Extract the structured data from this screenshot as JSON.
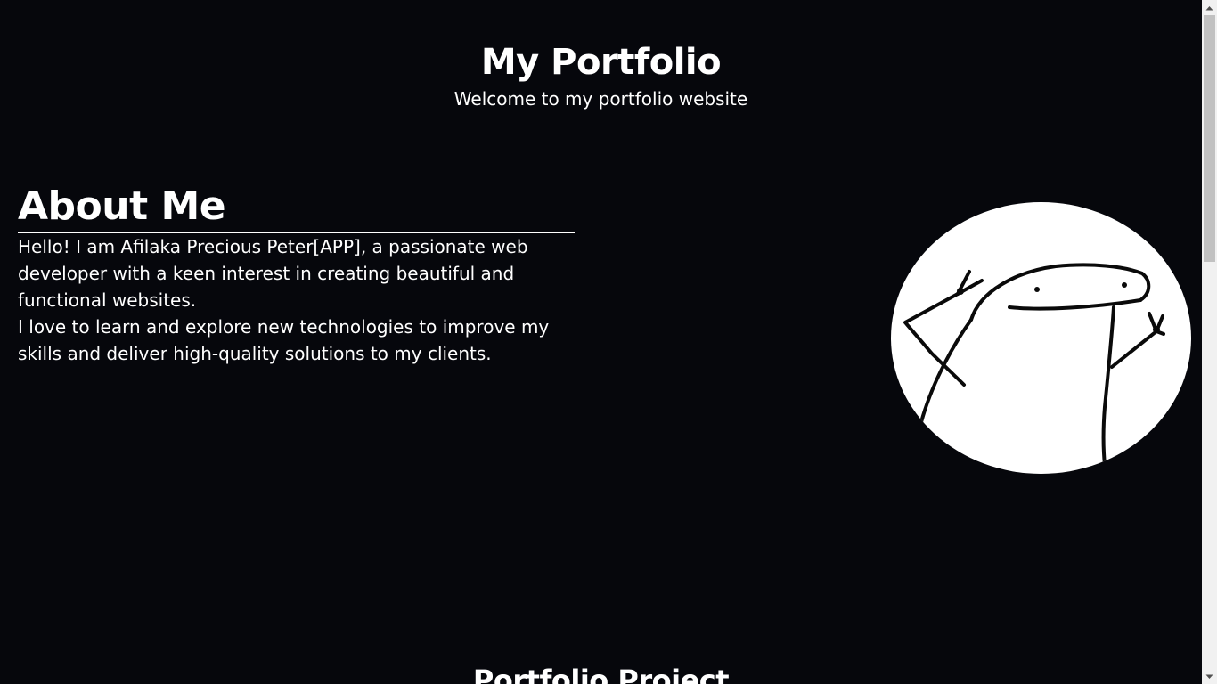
{
  "header": {
    "title": "My Portfolio",
    "subtitle": "Welcome to my portfolio website"
  },
  "about": {
    "heading": "About Me",
    "paragraph_1": "Hello! I am Afilaka Precious Peter[APP], a passionate web developer with a keen interest in creating beautiful and functional websites.",
    "paragraph_2": "I love to learn and explore new technologies to improve my skills and deliver high-quality solutions to my clients."
  },
  "avatar": {
    "icon": "stick-figure-drawing"
  },
  "projects": {
    "heading": "Portfolio Project"
  },
  "colors": {
    "background": "#06070c",
    "text": "#ffffff",
    "scrollbar_track": "#f1f1f1",
    "scrollbar_thumb": "#c1c1c1"
  }
}
